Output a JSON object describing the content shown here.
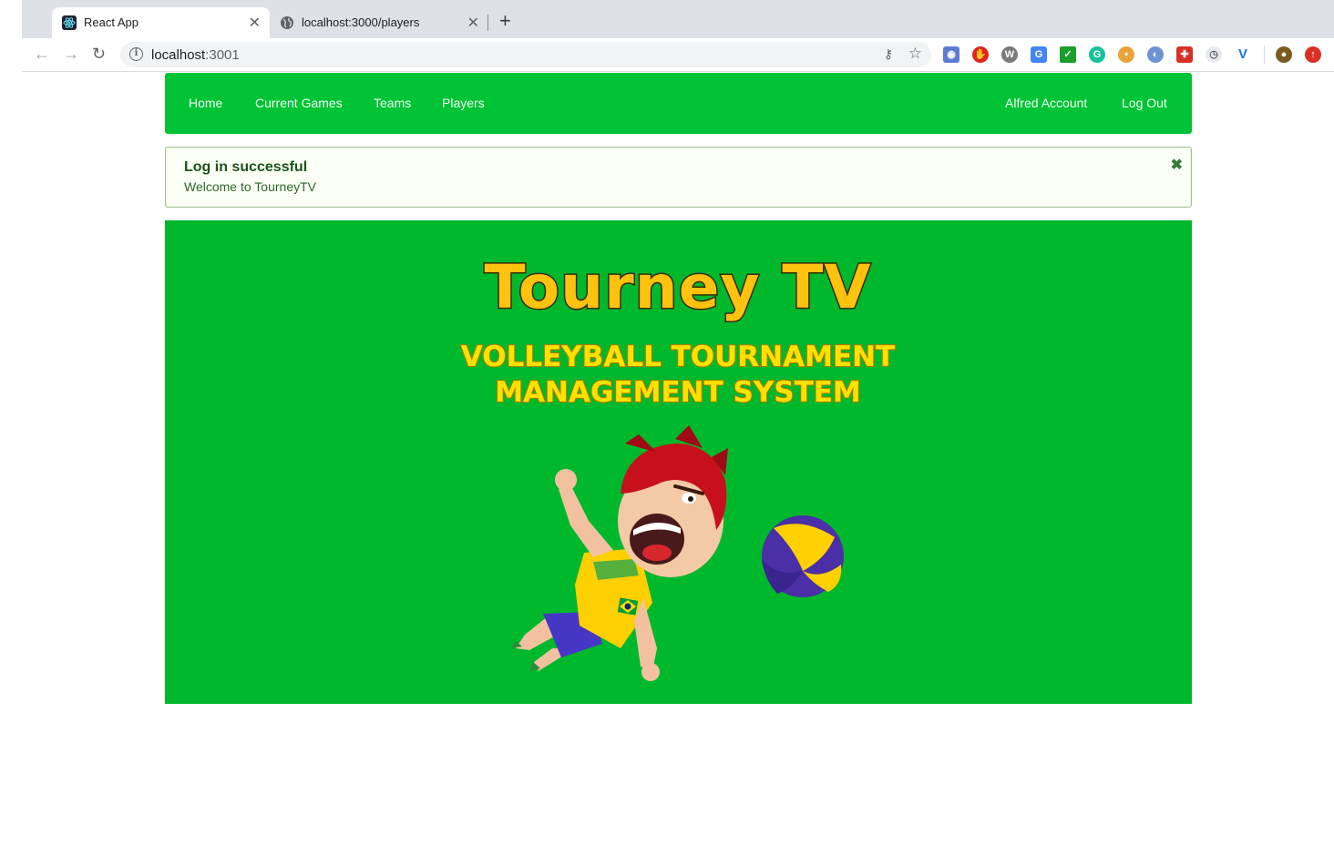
{
  "browser": {
    "tabs": [
      {
        "title": "React App",
        "icon": "react-icon",
        "active": true
      },
      {
        "title": "localhost:3000/players",
        "icon": "globe-icon",
        "active": false
      }
    ],
    "url_host": "localhost",
    "url_port": ":3001"
  },
  "navbar": {
    "left_items": [
      "Home",
      "Current Games",
      "Teams",
      "Players"
    ],
    "right_items": [
      "Alfred Account",
      "Log Out"
    ],
    "color": "#00c335"
  },
  "alert": {
    "header": "Log in successful",
    "message": "Welcome to TourneyTV"
  },
  "hero": {
    "title": "Tourney TV",
    "subtitle_line1": "VOLLEYBALL TOURNAMENT",
    "subtitle_line2": "MANAGEMENT SYSTEM",
    "background": "#00b82c",
    "title_color": "#ffc20e"
  }
}
